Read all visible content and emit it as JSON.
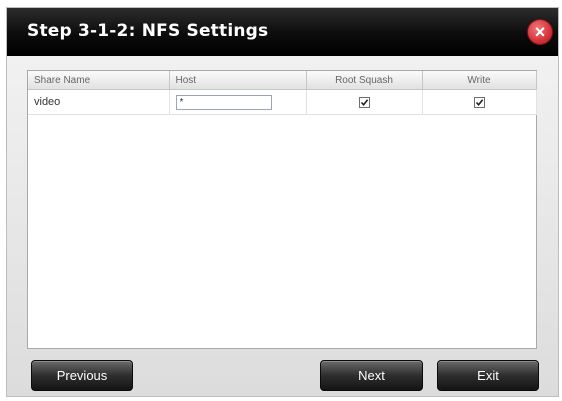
{
  "dialog": {
    "title": "Step 3-1-2: NFS Settings",
    "close_icon": "close-icon"
  },
  "table": {
    "columns": [
      "Share Name",
      "Host",
      "Root Squash",
      "Write"
    ],
    "rows": [
      {
        "share_name": "video",
        "host": "*",
        "root_squash": true,
        "write": true
      }
    ]
  },
  "buttons": {
    "previous": "Previous",
    "next": "Next",
    "exit": "Exit"
  },
  "colors": {
    "titlebar": "#000000",
    "close_button": "#d6323a",
    "button": "#2e2e2e"
  }
}
